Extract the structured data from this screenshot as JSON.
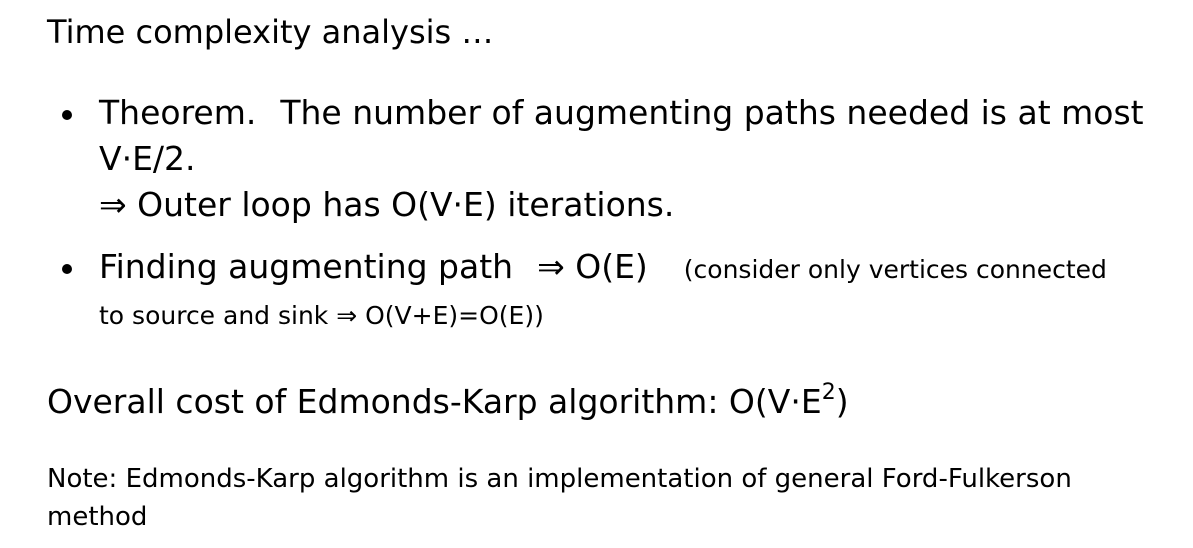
{
  "heading": "Time complexity analysis …",
  "bullets": {
    "theorem": {
      "label": "Theorem.",
      "text": "The number of augmenting paths needed is at most",
      "continuation": "V·E/2.",
      "consequence": "⇒ Outer loop has O(V·E) iterations."
    },
    "finding": {
      "text": "Finding augmenting path",
      "result": "⇒ O(E)",
      "note_start": "(consider only vertices connected",
      "note_end": "to source and sink ⇒ O(V+E)=O(E))"
    }
  },
  "overall": {
    "text": "Overall cost of Edmonds-Karp algorithm: O(V·E",
    "exponent": "2",
    "close": ")"
  },
  "note": "Note: Edmonds-Karp algorithm is an implementation of general Ford-Fulkerson method"
}
